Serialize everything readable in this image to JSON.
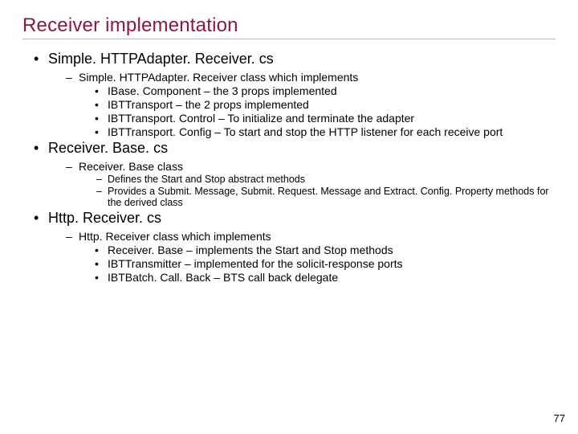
{
  "title": "Receiver implementation",
  "sections": [
    {
      "heading": "Simple. HTTPAdapter. Receiver. cs",
      "sub": [
        {
          "text": "Simple. HTTPAdapter. Receiver class which implements",
          "items": [
            "IBase. Component –  the 3 props implemented",
            "IBTTransport – the 2 props implemented",
            "IBTTransport. Control – To initialize and terminate the adapter",
            "IBTTransport. Config – To start and stop the HTTP listener for each receive port"
          ]
        }
      ]
    },
    {
      "heading": "Receiver. Base. cs",
      "sub": [
        {
          "text": "Receiver. Base class",
          "defs": [
            "Defines the Start and Stop abstract methods",
            "Provides a Submit. Message, Submit. Request. Message and Extract. Config. Property methods for the derived class"
          ]
        }
      ]
    },
    {
      "heading": "Http. Receiver. cs",
      "sub": [
        {
          "text": "Http. Receiver class which implements",
          "items": [
            "Receiver. Base – implements the Start and Stop methods",
            "IBTTransmitter – implemented for the solicit-response ports",
            "IBTBatch. Call. Back – BTS call back delegate"
          ]
        }
      ]
    }
  ],
  "page_number": "77"
}
